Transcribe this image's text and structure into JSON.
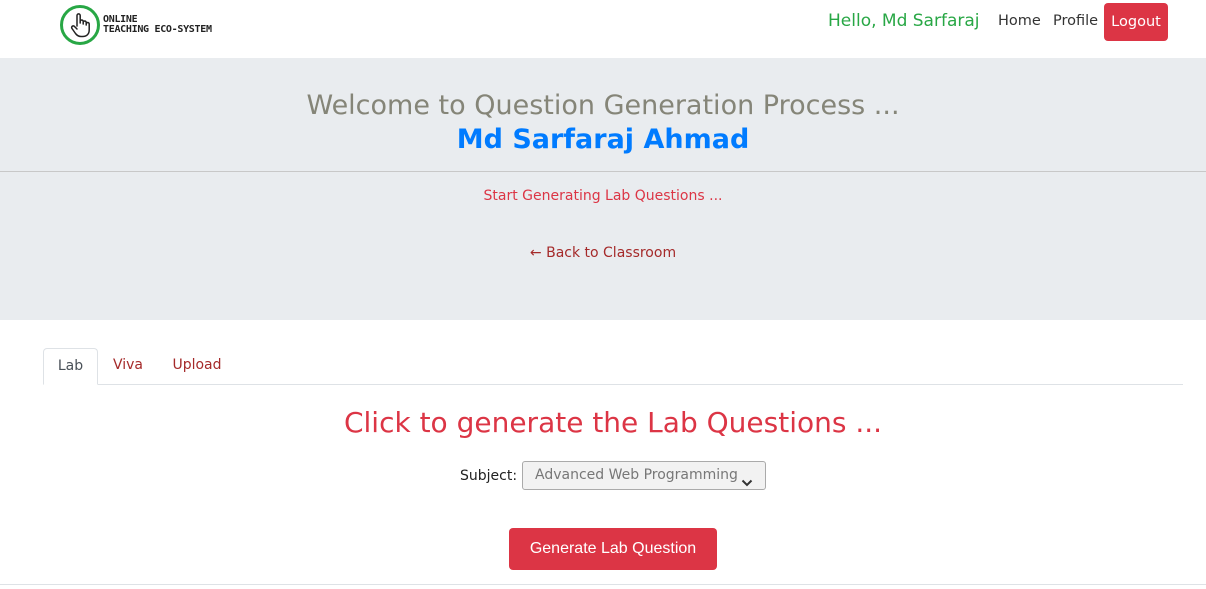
{
  "brand": {
    "line1": "ONLINE",
    "line2": "TEACHING ECO-SYSTEM",
    "accent_color": "#28a745",
    "icon": "pointer-hand-icon"
  },
  "nav": {
    "greeting": "Hello, Md Sarfaraj",
    "home": "Home",
    "profile": "Profile",
    "logout": "Logout"
  },
  "jumbotron": {
    "welcome": "Welcome to Question Generation Process ...",
    "username": "Md Sarfaraj Ahmad",
    "start_text": "Start Generating Lab Questions ...",
    "back_link": "← Back to Classroom"
  },
  "tabs": [
    {
      "label": "Lab",
      "active": true
    },
    {
      "label": "Viva",
      "active": false
    },
    {
      "label": "Upload",
      "active": false
    }
  ],
  "main": {
    "title": "Click to generate the Lab Questions ...",
    "subject_label": "Subject:",
    "subject_selected": "Advanced Web Programming",
    "generate_button": "Generate Lab Question"
  },
  "colors": {
    "danger": "#dc3545",
    "primary": "#007bff",
    "jumbotron_bg": "#e9ecef",
    "link": "#a52a2a"
  }
}
